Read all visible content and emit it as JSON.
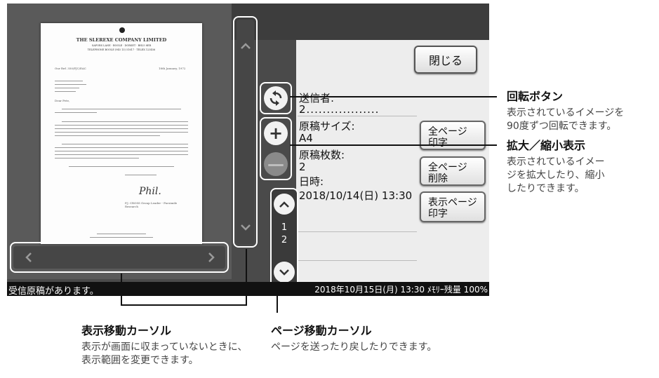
{
  "screen": {
    "close_label": "閉じる",
    "info": {
      "sender_label": "送信者:",
      "sender_value": "2..................",
      "size_label": "原稿サイズ:",
      "size_value": "A4",
      "count_label": "原稿枚数:",
      "count_value": "2",
      "date_label": "日時:",
      "date_value": "2018/10/14(日) 13:30"
    },
    "buttons": {
      "print_all": [
        "全ページ",
        "印字"
      ],
      "delete_all": [
        "全ページ",
        "削除"
      ],
      "print_shown": [
        "表示ページ",
        "印字"
      ]
    },
    "page_indicator": {
      "current": "1",
      "total": "2"
    },
    "status": {
      "left": "受信原稿があります。",
      "right": "2018年10月15日(月) 13:30 ﾒﾓﾘｰ残量 100%"
    },
    "document": {
      "company": "THE SLEREXE COMPANY LIMITED",
      "address": "SAPORS LANE · BOOLE · DORSET · BH25 8ER",
      "phone": "TELEPHONE BOOLE (945 13) 51617 · TELEX 123456",
      "ref": "Our Ref. 350/PJC/EAC",
      "date": "18th January, 1972",
      "salutation": "Dear Pete,",
      "sign_name": "Phil.",
      "sign_title": "P.J. CROSS Group Leader - Facsimile Research"
    }
  },
  "icons": {
    "rotate": "rotate-icon",
    "zoom_in": "plus-icon",
    "zoom_out": "minus-icon",
    "up": "chevron-up-icon",
    "down": "chevron-down-icon",
    "left": "chevron-left-icon",
    "right": "chevron-right-icon"
  },
  "annotations": {
    "rotate_title": "回転ボタン",
    "rotate_desc_1": "表示されているイメージを",
    "rotate_desc_2": "90度ずつ回転できます。",
    "zoom_title": "拡大／縮小表示",
    "zoom_desc_1": "表示されているイメー",
    "zoom_desc_2": "ジを拡大したり、縮小",
    "zoom_desc_3": "したりできます。",
    "scroll_title": "表示移動カーソル",
    "scroll_desc_1": "表示が画面に収まっていないときに、",
    "scroll_desc_2": "表示範囲を変更できます。",
    "page_title": "ページ移動カーソル",
    "page_desc": "ページを送ったり戻したりできます。"
  }
}
